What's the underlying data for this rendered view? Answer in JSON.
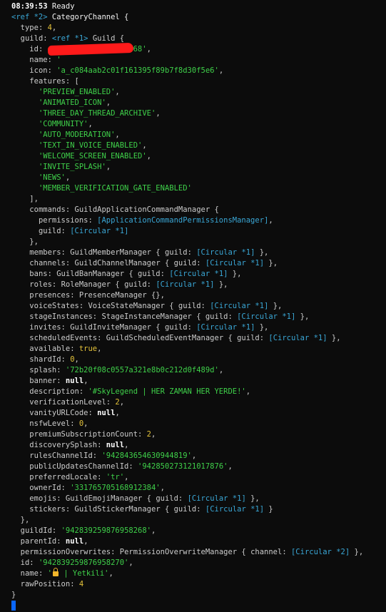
{
  "status": {
    "time": "08:39:53",
    "ready": "Ready"
  },
  "channel": {
    "ref_tag": "<ref *2>",
    "class_name": "CategoryChannel {",
    "type_key": "type:",
    "type_value": "4",
    "guild_key": "guild:",
    "guild_ref": "<ref *1>",
    "guild_class": "Guild {",
    "guild_id_key": "id:",
    "guild_id_partial": "68'",
    "name_key": "name:",
    "name_partial": "'",
    "icon_key": "icon:",
    "icon_value": "'a_c084aab2c01f161395f89b7f8d30f5e6'",
    "features_key": "features: [",
    "features": [
      "'PREVIEW_ENABLED'",
      "'ANIMATED_ICON'",
      "'THREE_DAY_THREAD_ARCHIVE'",
      "'COMMUNITY'",
      "'AUTO_MODERATION'",
      "'TEXT_IN_VOICE_ENABLED'",
      "'WELCOME_SCREEN_ENABLED'",
      "'INVITE_SPLASH'",
      "'NEWS'",
      "'MEMBER_VERIFICATION_GATE_ENABLED'"
    ],
    "features_close": "],",
    "commands_key": "commands:",
    "commands_class": "GuildApplicationCommandManager {",
    "permissions_key": "permissions:",
    "permissions_value": "[ApplicationCommandPermissionsManager]",
    "guild_circular_key": "guild:",
    "circular1": "[Circular *1]",
    "circular2": "[Circular *2]",
    "commands_close": "},",
    "managers": [
      {
        "key": "members:",
        "cls": "GuildMemberManager { guild:",
        "end": " },"
      },
      {
        "key": "channels:",
        "cls": "GuildChannelManager { guild:",
        "end": " },"
      },
      {
        "key": "bans:",
        "cls": "GuildBanManager { guild:",
        "end": " },"
      },
      {
        "key": "roles:",
        "cls": "RoleManager { guild:",
        "end": " },"
      }
    ],
    "presences_key": "presences:",
    "presences_value": "PresenceManager {},",
    "managers2": [
      {
        "key": "voiceStates:",
        "cls": "VoiceStateManager { guild:",
        "end": " },"
      },
      {
        "key": "stageInstances:",
        "cls": "StageInstanceManager { guild:",
        "end": " },"
      },
      {
        "key": "invites:",
        "cls": "GuildInviteManager { guild:",
        "end": " },"
      },
      {
        "key": "scheduledEvents:",
        "cls": "GuildScheduledEventManager { guild:",
        "end": " },"
      }
    ],
    "available_key": "available:",
    "available_value": "true",
    "shardId_key": "shardId:",
    "shardId_value": "0",
    "splash_key": "splash:",
    "splash_value": "'72b20f08c0557a321e8b0c212d0f489d'",
    "banner_key": "banner:",
    "null": "null",
    "description_key": "description:",
    "description_value": "'#SkyLegend | HER ZAMAN HER YERDE!'",
    "verificationLevel_key": "verificationLevel:",
    "verificationLevel_value": "2",
    "vanityURLCode_key": "vanityURLCode:",
    "nsfwLevel_key": "nsfwLevel:",
    "nsfwLevel_value": "0",
    "premiumSubscriptionCount_key": "premiumSubscriptionCount:",
    "premiumSubscriptionCount_value": "2",
    "discoverySplash_key": "discoverySplash:",
    "rulesChannelId_key": "rulesChannelId:",
    "rulesChannelId_value": "'942843654630944819'",
    "publicUpdatesChannelId_key": "publicUpdatesChannelId:",
    "publicUpdatesChannelId_value": "'942850273121017876'",
    "preferredLocale_key": "preferredLocale:",
    "preferredLocale_value": "'tr'",
    "ownerId_key": "ownerId:",
    "ownerId_value": "'331765705168912384'",
    "emojis_key": "emojis:",
    "emojis_cls": "GuildEmojiManager { guild:",
    "stickers_key": "stickers:",
    "stickers_cls": "GuildStickerManager { guild:",
    "guild_close": "},",
    "guildId_key": "guildId:",
    "guildId_value": "'942839259876958268'",
    "parentId_key": "parentId:",
    "permissionOverwrites_key": "permissionOverwrites:",
    "permissionOverwrites_cls": "PermissionOverwriteManager { channel:",
    "id_key": "id:",
    "id_value": "'942839259876958270'",
    "name2_key": "name:",
    "name2_quote_open": "'",
    "name2_text": " | Yetkili'",
    "rawPosition_key": "rawPosition:",
    "rawPosition_value": "4",
    "close": "}"
  }
}
